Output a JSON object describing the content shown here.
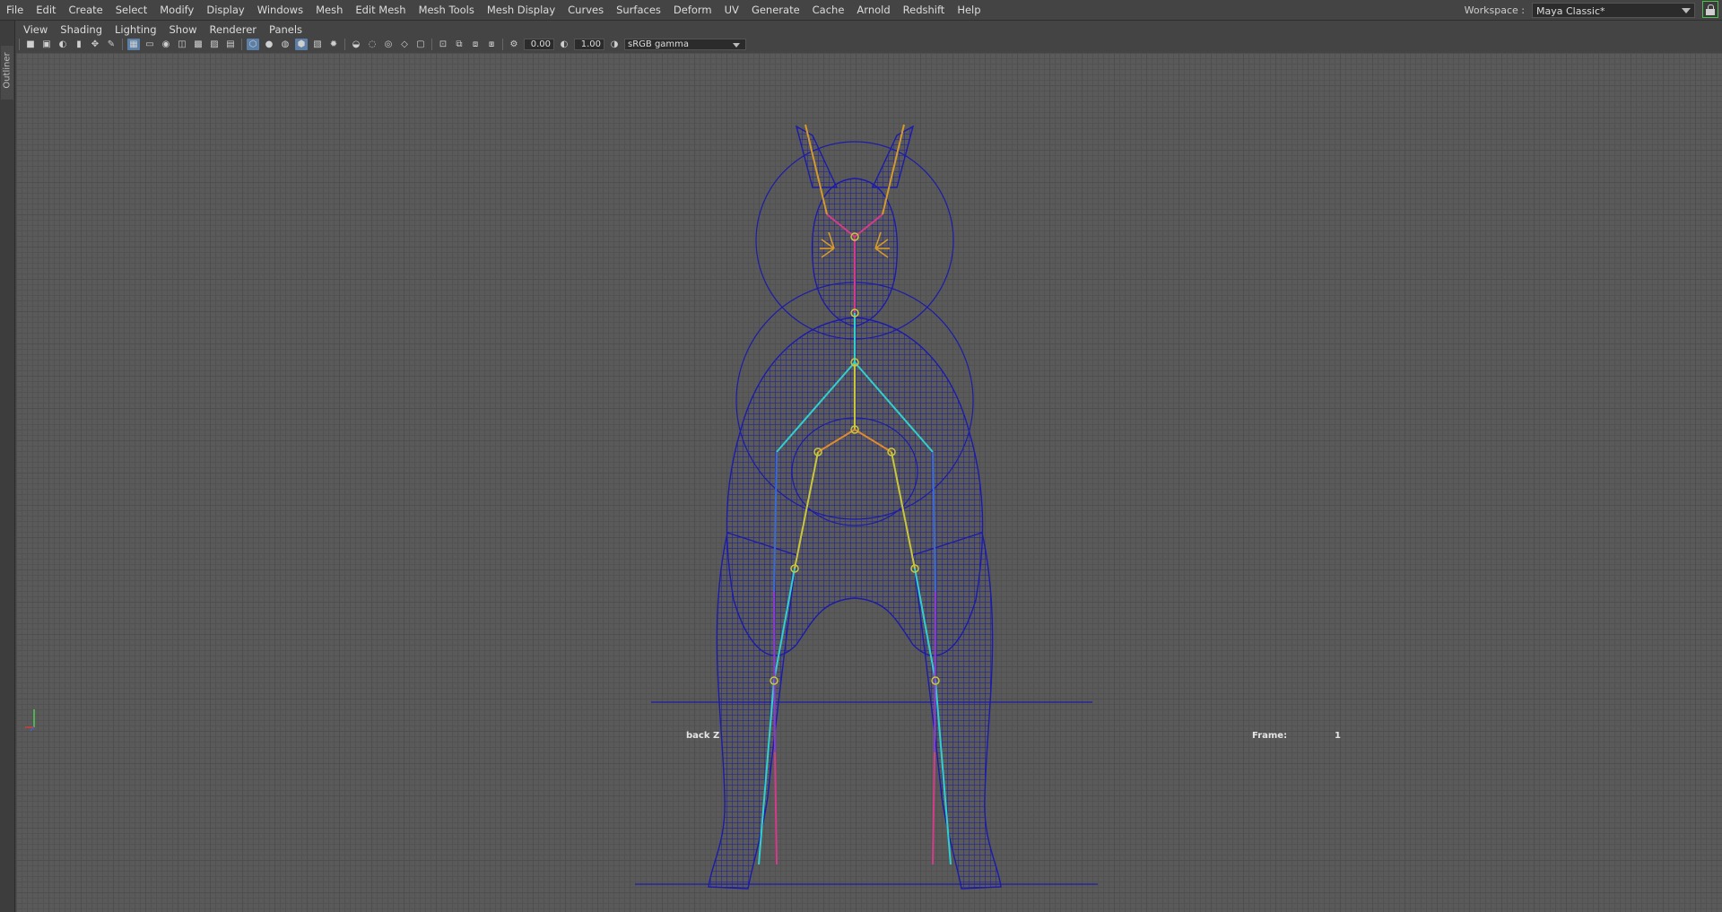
{
  "menubar": {
    "items": [
      "File",
      "Edit",
      "Create",
      "Select",
      "Modify",
      "Display",
      "Windows",
      "Mesh",
      "Edit Mesh",
      "Mesh Tools",
      "Mesh Display",
      "Curves",
      "Surfaces",
      "Deform",
      "UV",
      "Generate",
      "Cache",
      "Arnold",
      "Redshift",
      "Help"
    ]
  },
  "workspace": {
    "label": "Workspace :",
    "value": "Maya Classic*"
  },
  "outliner": {
    "tab_label": "Outliner"
  },
  "panel_menu": {
    "items": [
      "View",
      "Shading",
      "Lighting",
      "Show",
      "Renderer",
      "Panels"
    ]
  },
  "toolbar": {
    "exposure": "0.00",
    "gamma": "1.00",
    "color_space": "sRGB gamma",
    "icons": [
      "select-camera-icon",
      "camera-attributes-icon",
      "bookmark-icon",
      "image-plane-icon",
      "two-d-pan-icon",
      "grease-pencil-icon",
      "grid-icon",
      "film-gate-icon",
      "resolution-gate-icon",
      "gate-mask-icon",
      "field-chart-icon",
      "safe-action-icon",
      "safe-title-icon",
      "wireframe-icon",
      "smooth-shade-icon",
      "default-material-icon",
      "wireframe-on-shaded-icon",
      "textured-icon",
      "lights-icon",
      "shadows-icon",
      "screen-space-ao-icon",
      "motion-blur-icon",
      "anti-aliasing-icon",
      "depth-of-field-icon",
      "isolate-select-icon",
      "xray-icon",
      "xray-joints-icon",
      "xray-active-icon",
      "exposure-icon",
      "gamma-icon",
      "color-management-icon"
    ]
  },
  "viewport": {
    "camera_name": "back Z",
    "frame_label": "Frame:",
    "frame_value": "1",
    "mesh_color": "#1c1ca8",
    "background_color": "#5a5a5a"
  }
}
